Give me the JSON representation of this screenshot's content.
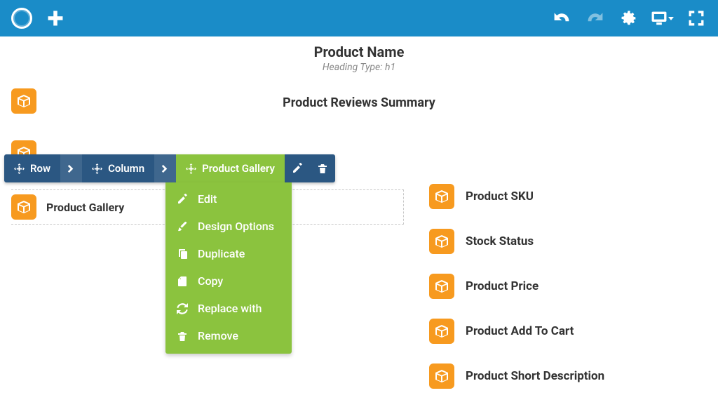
{
  "colors": {
    "toolbar": "#1a8cc8",
    "crumbBg": "#2b5782",
    "active": "#8bc33e",
    "box": "#f79a1f"
  },
  "header": {
    "title": "Product Name",
    "subtitle": "Heading Type: h1"
  },
  "sectionTitle": "Product Reviews Summary",
  "leftItem": {
    "label": "Product Gallery"
  },
  "rightItems": [
    {
      "label": "Product SKU"
    },
    {
      "label": "Stock Status"
    },
    {
      "label": "Product Price"
    },
    {
      "label": "Product Add To Cart"
    },
    {
      "label": "Product Short Description"
    }
  ],
  "breadcrumb": {
    "row": "Row",
    "column": "Column",
    "active": "Product Gallery"
  },
  "dropdown": [
    {
      "icon": "pencil",
      "label": "Edit"
    },
    {
      "icon": "brush",
      "label": "Design Options"
    },
    {
      "icon": "copy",
      "label": "Duplicate"
    },
    {
      "icon": "clip",
      "label": "Copy"
    },
    {
      "icon": "refresh",
      "label": "Replace with"
    },
    {
      "icon": "trash",
      "label": "Remove"
    }
  ]
}
